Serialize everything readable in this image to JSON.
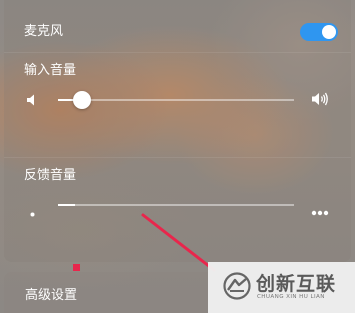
{
  "microphone": {
    "label": "麦克风",
    "toggle_on": true,
    "toggle_color": "#2f96f0"
  },
  "input_volume": {
    "label": "输入音量",
    "level_fraction": 0.1,
    "low_icon": "speaker-low-icon",
    "high_icon": "speaker-high-icon"
  },
  "feedback_volume": {
    "label": "反馈音量",
    "level_fraction": 0.07,
    "low_icon": "dot-small-icon",
    "high_icon": "dots-large-icon"
  },
  "advanced": {
    "label": "高级设置"
  },
  "watermark": {
    "title": "创新互联",
    "subtitle": "CHUANG XIN HU LIAN"
  },
  "colors": {
    "annotation": "#e8264c"
  }
}
